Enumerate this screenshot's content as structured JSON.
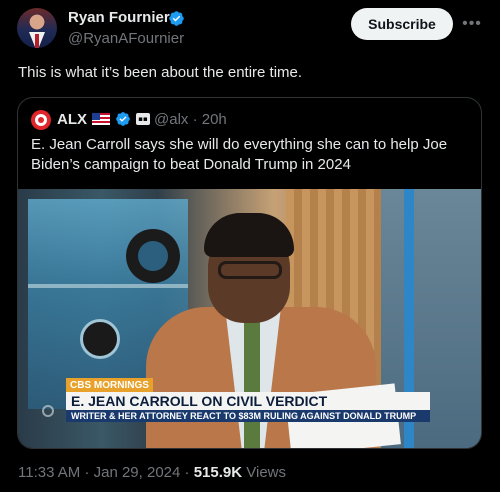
{
  "post": {
    "author": {
      "name": "Ryan Fournier",
      "handle": "@RyanAFournier",
      "avatar_icon": "profile-photo"
    },
    "subscribe_label": "Subscribe",
    "more_icon": "more-horizontal-icon",
    "text": "This is what it’s been about the entire time.",
    "meta": {
      "time": "11:33 AM",
      "separator1": "·",
      "date": "Jan 29, 2024",
      "separator2": "·",
      "views_count": "515.9K",
      "views_label": "Views"
    }
  },
  "quote": {
    "author": {
      "name": "ALX",
      "handle": "@alx",
      "dot": "·",
      "time": "20h",
      "flag_icon": "us-flag-icon",
      "badge_icon": "affiliate-badge-icon"
    },
    "text": "E. Jean Carroll says she will do everything she can to help Joe Biden’s campaign to beat Donald Trump in 2024",
    "media": {
      "tag": "CBS MORNINGS",
      "headline": "E. JEAN CARROLL ON CIVIL VERDICT",
      "subheadline": "WRITER & HER ATTORNEY REACT TO $83M RULING AGAINST DONALD TRUMP"
    }
  },
  "colors": {
    "background": "#000000",
    "text_primary": "#e7e9ea",
    "text_secondary": "#71767b",
    "verified_blue": "#1d9bf0",
    "border": "#2f3336",
    "subscribe_bg": "#eff3f4"
  }
}
